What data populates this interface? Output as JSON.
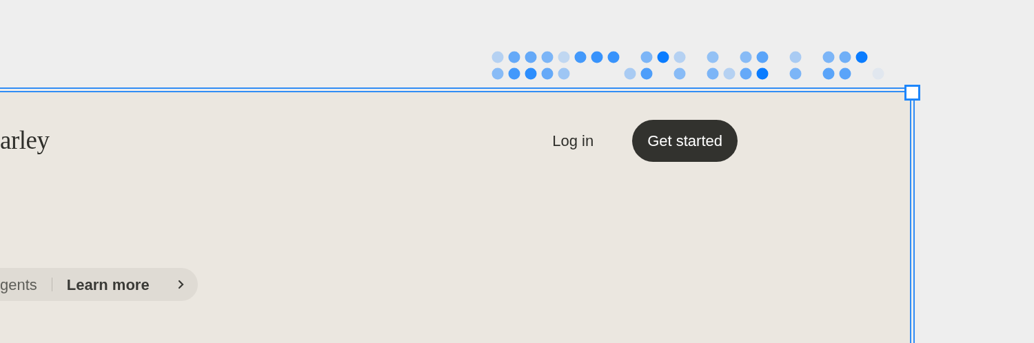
{
  "brand": "arley",
  "nav": [
    {
      "label": "Log in",
      "kind": "link"
    },
    {
      "label": "Get started",
      "kind": "button"
    }
  ],
  "announcement": {
    "text": "gents",
    "link": "Learn more"
  }
}
